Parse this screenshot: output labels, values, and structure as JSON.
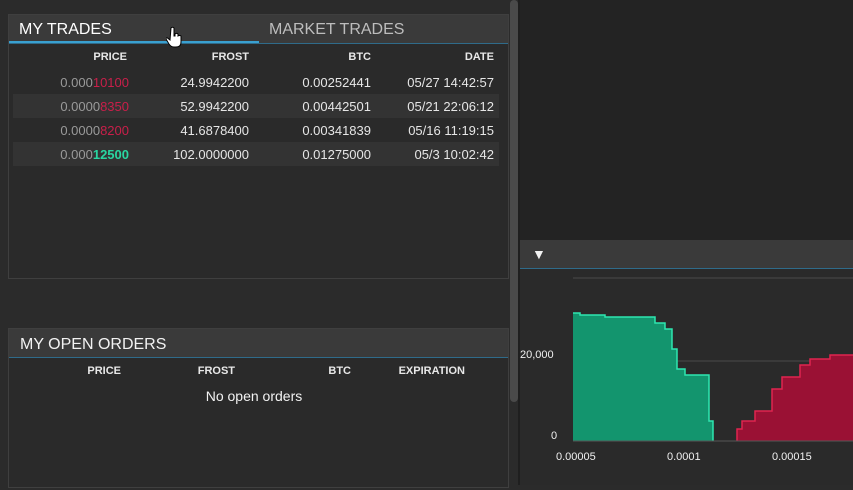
{
  "trades": {
    "tabs": [
      "MY TRADES",
      "MARKET TRADES"
    ],
    "columns": [
      "PRICE",
      "FROST",
      "BTC",
      "DATE"
    ],
    "rows": [
      {
        "price_prefix": "0.000",
        "price_suffix": "10100",
        "color": "red",
        "frost": "24.9942200",
        "btc": "0.00252441",
        "date": "05/27 14:42:57"
      },
      {
        "price_prefix": "0.0000",
        "price_suffix": "8350",
        "color": "red",
        "frost": "52.9942200",
        "btc": "0.00442501",
        "date": "05/21 22:06:12"
      },
      {
        "price_prefix": "0.0000",
        "price_suffix": "8200",
        "color": "red",
        "frost": "41.6878400",
        "btc": "0.00341839",
        "date": "05/16 11:19:15"
      },
      {
        "price_prefix": "0.000",
        "price_suffix": "12500",
        "color": "green",
        "frost": "102.0000000",
        "btc": "0.01275000",
        "date": "05/3 10:02:42"
      }
    ]
  },
  "open_orders": {
    "title": "MY OPEN ORDERS",
    "columns": [
      "PRICE",
      "FROST",
      "BTC",
      "EXPIRATION"
    ],
    "empty_text": "No open orders"
  },
  "depth_chart": {
    "toggle_icon": "triangle-down-icon",
    "toggle_glyph": "▼",
    "y_ticks": [
      "20,000",
      "0"
    ],
    "x_ticks": [
      "0.00005",
      "0.0001",
      "0.00015"
    ],
    "colors": {
      "bid": "#13956e",
      "bid_line": "#2ee6b0",
      "ask": "#9a1134",
      "ask_line": "#e0244f"
    }
  }
}
